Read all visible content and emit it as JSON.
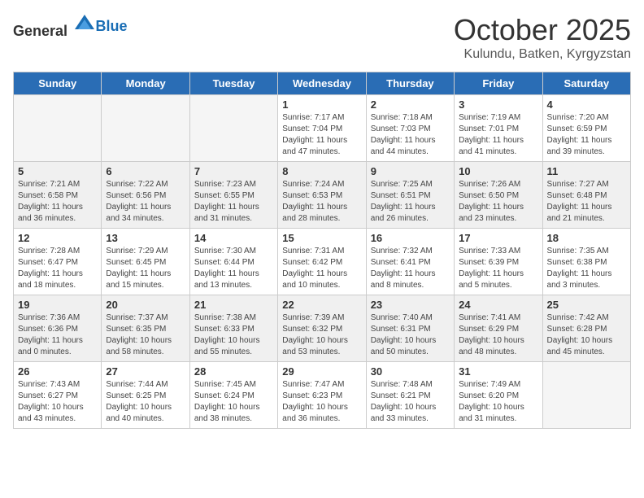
{
  "header": {
    "logo_general": "General",
    "logo_blue": "Blue",
    "month": "October 2025",
    "location": "Kulundu, Batken, Kyrgyzstan"
  },
  "days_of_week": [
    "Sunday",
    "Monday",
    "Tuesday",
    "Wednesday",
    "Thursday",
    "Friday",
    "Saturday"
  ],
  "weeks": [
    [
      {
        "day": "",
        "info": ""
      },
      {
        "day": "",
        "info": ""
      },
      {
        "day": "",
        "info": ""
      },
      {
        "day": "1",
        "info": "Sunrise: 7:17 AM\nSunset: 7:04 PM\nDaylight: 11 hours and 47 minutes."
      },
      {
        "day": "2",
        "info": "Sunrise: 7:18 AM\nSunset: 7:03 PM\nDaylight: 11 hours and 44 minutes."
      },
      {
        "day": "3",
        "info": "Sunrise: 7:19 AM\nSunset: 7:01 PM\nDaylight: 11 hours and 41 minutes."
      },
      {
        "day": "4",
        "info": "Sunrise: 7:20 AM\nSunset: 6:59 PM\nDaylight: 11 hours and 39 minutes."
      }
    ],
    [
      {
        "day": "5",
        "info": "Sunrise: 7:21 AM\nSunset: 6:58 PM\nDaylight: 11 hours and 36 minutes."
      },
      {
        "day": "6",
        "info": "Sunrise: 7:22 AM\nSunset: 6:56 PM\nDaylight: 11 hours and 34 minutes."
      },
      {
        "day": "7",
        "info": "Sunrise: 7:23 AM\nSunset: 6:55 PM\nDaylight: 11 hours and 31 minutes."
      },
      {
        "day": "8",
        "info": "Sunrise: 7:24 AM\nSunset: 6:53 PM\nDaylight: 11 hours and 28 minutes."
      },
      {
        "day": "9",
        "info": "Sunrise: 7:25 AM\nSunset: 6:51 PM\nDaylight: 11 hours and 26 minutes."
      },
      {
        "day": "10",
        "info": "Sunrise: 7:26 AM\nSunset: 6:50 PM\nDaylight: 11 hours and 23 minutes."
      },
      {
        "day": "11",
        "info": "Sunrise: 7:27 AM\nSunset: 6:48 PM\nDaylight: 11 hours and 21 minutes."
      }
    ],
    [
      {
        "day": "12",
        "info": "Sunrise: 7:28 AM\nSunset: 6:47 PM\nDaylight: 11 hours and 18 minutes."
      },
      {
        "day": "13",
        "info": "Sunrise: 7:29 AM\nSunset: 6:45 PM\nDaylight: 11 hours and 15 minutes."
      },
      {
        "day": "14",
        "info": "Sunrise: 7:30 AM\nSunset: 6:44 PM\nDaylight: 11 hours and 13 minutes."
      },
      {
        "day": "15",
        "info": "Sunrise: 7:31 AM\nSunset: 6:42 PM\nDaylight: 11 hours and 10 minutes."
      },
      {
        "day": "16",
        "info": "Sunrise: 7:32 AM\nSunset: 6:41 PM\nDaylight: 11 hours and 8 minutes."
      },
      {
        "day": "17",
        "info": "Sunrise: 7:33 AM\nSunset: 6:39 PM\nDaylight: 11 hours and 5 minutes."
      },
      {
        "day": "18",
        "info": "Sunrise: 7:35 AM\nSunset: 6:38 PM\nDaylight: 11 hours and 3 minutes."
      }
    ],
    [
      {
        "day": "19",
        "info": "Sunrise: 7:36 AM\nSunset: 6:36 PM\nDaylight: 11 hours and 0 minutes."
      },
      {
        "day": "20",
        "info": "Sunrise: 7:37 AM\nSunset: 6:35 PM\nDaylight: 10 hours and 58 minutes."
      },
      {
        "day": "21",
        "info": "Sunrise: 7:38 AM\nSunset: 6:33 PM\nDaylight: 10 hours and 55 minutes."
      },
      {
        "day": "22",
        "info": "Sunrise: 7:39 AM\nSunset: 6:32 PM\nDaylight: 10 hours and 53 minutes."
      },
      {
        "day": "23",
        "info": "Sunrise: 7:40 AM\nSunset: 6:31 PM\nDaylight: 10 hours and 50 minutes."
      },
      {
        "day": "24",
        "info": "Sunrise: 7:41 AM\nSunset: 6:29 PM\nDaylight: 10 hours and 48 minutes."
      },
      {
        "day": "25",
        "info": "Sunrise: 7:42 AM\nSunset: 6:28 PM\nDaylight: 10 hours and 45 minutes."
      }
    ],
    [
      {
        "day": "26",
        "info": "Sunrise: 7:43 AM\nSunset: 6:27 PM\nDaylight: 10 hours and 43 minutes."
      },
      {
        "day": "27",
        "info": "Sunrise: 7:44 AM\nSunset: 6:25 PM\nDaylight: 10 hours and 40 minutes."
      },
      {
        "day": "28",
        "info": "Sunrise: 7:45 AM\nSunset: 6:24 PM\nDaylight: 10 hours and 38 minutes."
      },
      {
        "day": "29",
        "info": "Sunrise: 7:47 AM\nSunset: 6:23 PM\nDaylight: 10 hours and 36 minutes."
      },
      {
        "day": "30",
        "info": "Sunrise: 7:48 AM\nSunset: 6:21 PM\nDaylight: 10 hours and 33 minutes."
      },
      {
        "day": "31",
        "info": "Sunrise: 7:49 AM\nSunset: 6:20 PM\nDaylight: 10 hours and 31 minutes."
      },
      {
        "day": "",
        "info": ""
      }
    ]
  ]
}
